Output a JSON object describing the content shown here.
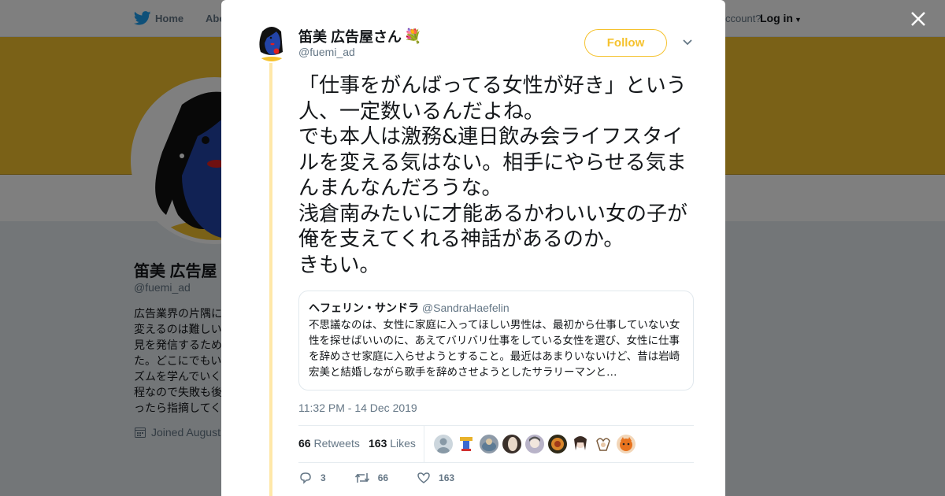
{
  "background": {
    "nav": {
      "home": "Home",
      "about": "Abo",
      "account_prompt": "ccount?",
      "login": "Log in"
    },
    "profile": {
      "name": "笛美 広告屋",
      "handle": "@fuemi_ad",
      "bio": "広告業界の片隅に\n変えるのは難しい\n見を発信するため\nた。どこにでもい\nズムを学んでいく\n程なので失敗も後\nったら指摘してく",
      "joined": "Joined August"
    }
  },
  "modal": {
    "author": {
      "name": "笛美 広告屋さん",
      "emoji": "💐",
      "handle": "@fuemi_ad"
    },
    "follow_label": "Follow",
    "tweet_text": "「仕事をがんばってる女性が好き」という人、一定数いるんだよね。\nでも本人は激務&連日飲み会ライフスタイルを変える気はない。相手にやらせる気まんまんなんだろうな。\n浅倉南みたいに才能あるかわいい女の子が俺を支えてくれる神話があるのか。\nきもい。",
    "quote": {
      "name": "ヘフェリン・サンドラ",
      "handle": "@SandraHaefelin",
      "text": "不思議なのは、女性に家庭に入ってほしい男性は、最初から仕事していない女性を探せばいいのに、あえてバリバリ仕事をしている女性を選び、女性に仕事を辞めさせ家庭に入らせようとすること。最近はあまりいないけど、昔は岩崎宏美と結婚しながら歌手を辞めさせようとしたサラリーマンと…"
    },
    "timestamp": "11:32 PM - 14 Dec 2019",
    "stats": {
      "retweets_count": "66",
      "retweets_label": "Retweets",
      "likes_count": "163",
      "likes_label": "Likes"
    },
    "actions": {
      "replies": "3",
      "retweets": "66",
      "likes": "163"
    }
  },
  "colors": {
    "accent": "#f5c22e",
    "banner": "#f5c22e",
    "thread_line": "#ffe8a8",
    "avatar_blue": "#2344a8"
  }
}
